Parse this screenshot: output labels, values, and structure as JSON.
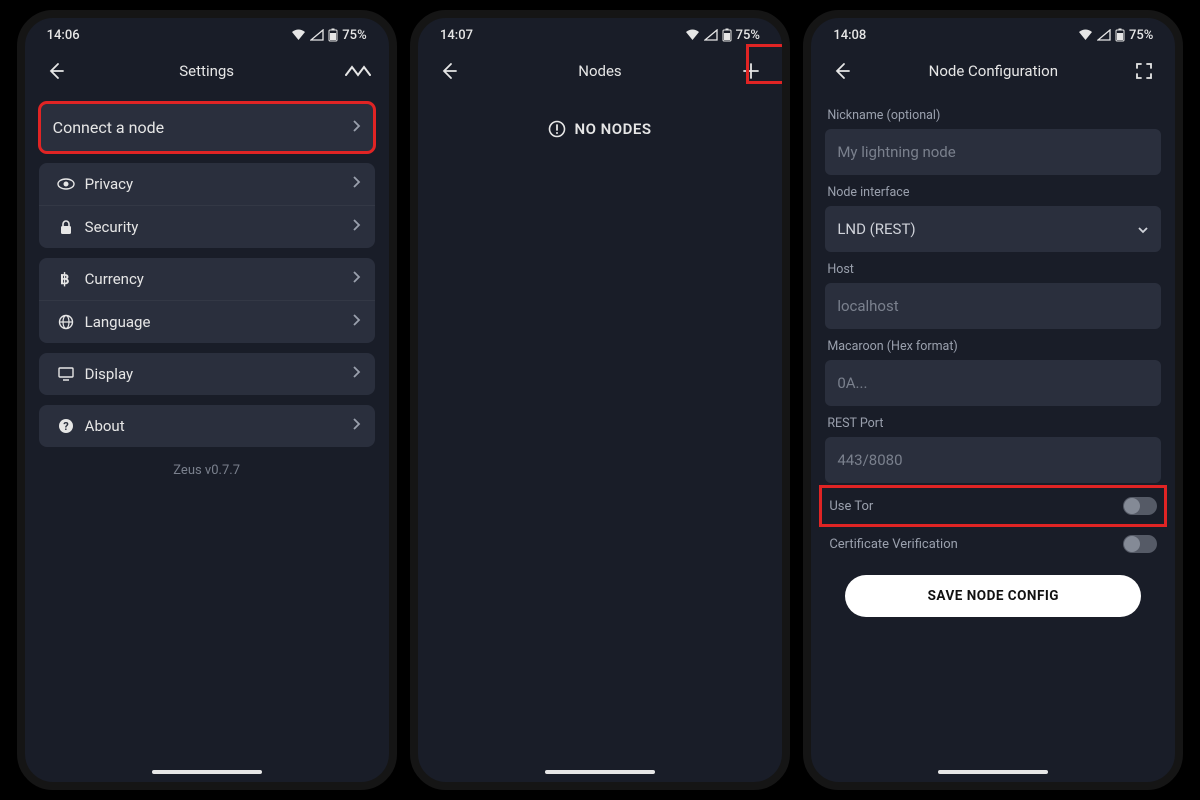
{
  "screen1": {
    "time": "14:06",
    "battery": "75%",
    "title": "Settings",
    "connect_label": "Connect a node",
    "items": {
      "privacy": "Privacy",
      "security": "Security",
      "currency": "Currency",
      "language": "Language",
      "display": "Display",
      "about": "About"
    },
    "version": "Zeus v0.7.7"
  },
  "screen2": {
    "time": "14:07",
    "battery": "75%",
    "title": "Nodes",
    "empty": "NO NODES"
  },
  "screen3": {
    "time": "14:08",
    "battery": "75%",
    "title": "Node Configuration",
    "labels": {
      "nickname": "Nickname (optional)",
      "interface": "Node interface",
      "host": "Host",
      "macaroon": "Macaroon (Hex format)",
      "port": "REST Port",
      "tor": "Use Tor",
      "cert": "Certificate Verification"
    },
    "placeholders": {
      "nickname": "My lightning node",
      "interface": "LND (REST)",
      "host": "localhost",
      "macaroon": "0A...",
      "port": "443/8080"
    },
    "save": "SAVE NODE CONFIG"
  }
}
